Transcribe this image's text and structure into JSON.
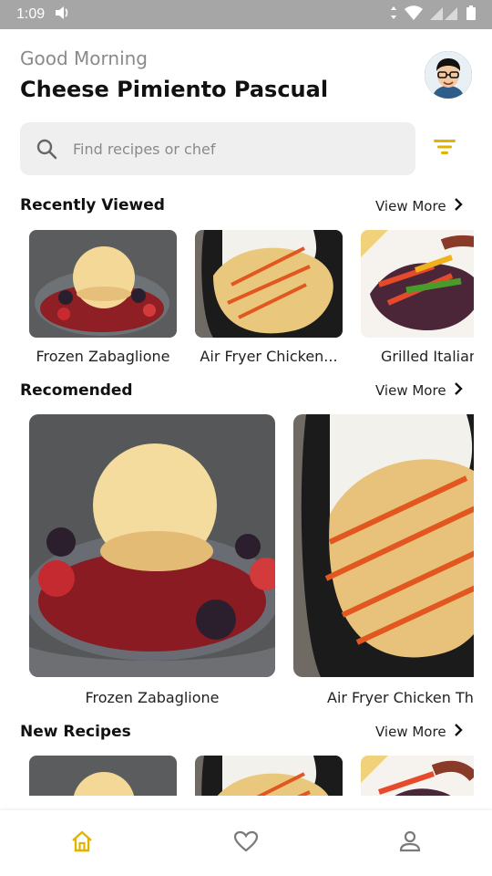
{
  "status": {
    "time": "1:09"
  },
  "header": {
    "greeting": "Good Morning",
    "user_name": "Cheese Pimiento Pascual"
  },
  "search": {
    "placeholder": "Find recipes or chef",
    "value": ""
  },
  "sections": {
    "recently_viewed": {
      "title": "Recently Viewed",
      "view_more": "View More"
    },
    "recommended": {
      "title": "Recomended",
      "view_more": "View More"
    },
    "new_recipes": {
      "title": "New Recipes",
      "view_more": "View More"
    }
  },
  "recently_viewed_items": [
    {
      "caption": "Frozen Zabaglione"
    },
    {
      "caption": "Air Fryer Chicken..."
    },
    {
      "caption": "Grilled Italian"
    }
  ],
  "recommended_items": [
    {
      "caption": "Frozen Zabaglione"
    },
    {
      "caption": "Air Fryer Chicken Th"
    }
  ],
  "nav": {
    "active": "home",
    "tabs": [
      {
        "icon": "home-icon"
      },
      {
        "icon": "heart-icon"
      },
      {
        "icon": "profile-icon"
      }
    ]
  },
  "colors": {
    "accent": "#e0b400",
    "icon_gray": "#7a7a7a"
  }
}
